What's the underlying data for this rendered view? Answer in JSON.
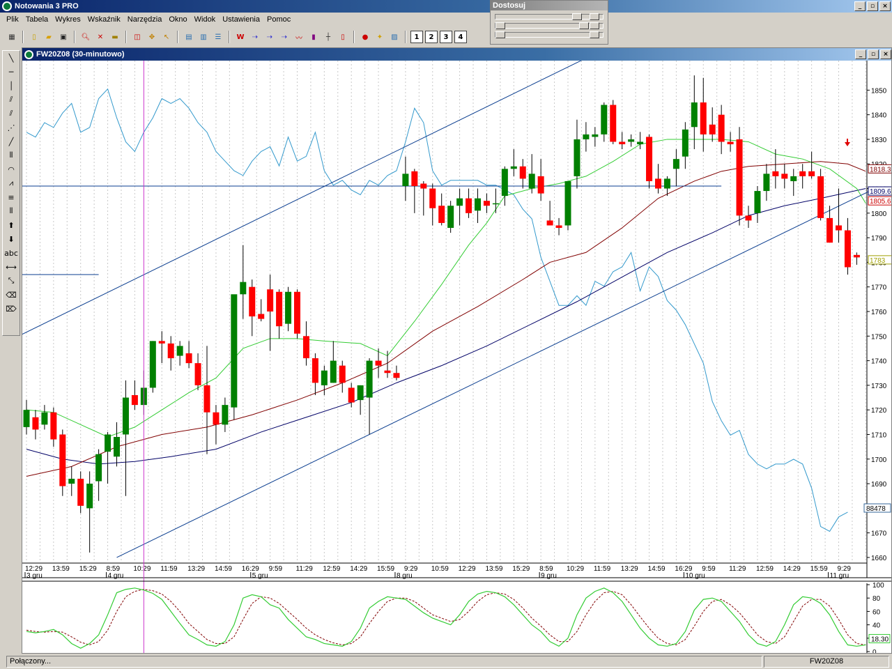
{
  "app": {
    "title": "Notowania 3 PRO",
    "window_buttons": [
      "_",
      "▫",
      "×"
    ]
  },
  "menu": [
    "Plik",
    "Tabela",
    "Wykres",
    "Wskaźnik",
    "Narzędzia",
    "Okno",
    "Widok",
    "Ustawienia",
    "Pomoc"
  ],
  "toolbar": {
    "number_buttons": [
      "1",
      "2",
      "3",
      "4"
    ]
  },
  "dostosuj": {
    "title": "Dostosuj"
  },
  "left_tools": {
    "text_tool": "abc"
  },
  "chart_window": {
    "title": "FW20Z08 (30-minutowo)",
    "window_buttons": [
      "_",
      "▫",
      "×"
    ]
  },
  "status": {
    "connection": "Połączony...",
    "symbol": "FW20Z08"
  },
  "colors": {
    "candle_up": "#008000",
    "candle_down": "#ff0000",
    "volume_line": "#3399cc",
    "ma_fast": "#33cc33",
    "ma_mid": "#800000",
    "ma_slow": "#000066",
    "trend_line": "#0a3d8f",
    "cursor_line": "#cc33cc",
    "stoch_k": "#33cc33",
    "stoch_d": "#800000"
  },
  "chart_data": {
    "type": "candlestick",
    "y_ticks": [
      1660,
      1670,
      1680,
      1690,
      1700,
      1710,
      1720,
      1730,
      1740,
      1750,
      1760,
      1770,
      1780,
      1790,
      1800,
      1810,
      1820,
      1830,
      1840,
      1850
    ],
    "ylim": [
      1658,
      1862
    ],
    "time_labels": [
      "12:29",
      "13:59",
      "15:29",
      "8:59",
      "10:29",
      "11:59",
      "13:29",
      "14:59",
      "16:29",
      "9:59",
      "11:29",
      "12:59",
      "14:29",
      "15:59",
      "9:29",
      "10:59",
      "12:29",
      "13:59",
      "15:29",
      "8:59",
      "10:29",
      "11:59",
      "13:29",
      "14:59",
      "16:29",
      "9:59",
      "11:29",
      "12:59",
      "14:29",
      "15:59",
      "9:29"
    ],
    "date_labels": [
      {
        "label": "3 gru",
        "index": 0
      },
      {
        "label": "4 gru",
        "index": 9
      },
      {
        "label": "5 gru",
        "index": 25
      },
      {
        "label": "8 gru",
        "index": 41
      },
      {
        "label": "9 gru",
        "index": 57
      },
      {
        "label": "10 gru",
        "index": 73
      },
      {
        "label": "11 gru",
        "index": 89
      }
    ],
    "candles": [
      {
        "o": 1713,
        "h": 1724,
        "l": 1710,
        "c": 1720
      },
      {
        "o": 1717,
        "h": 1720,
        "l": 1708,
        "c": 1712
      },
      {
        "o": 1714,
        "h": 1722,
        "l": 1712,
        "c": 1719
      },
      {
        "o": 1719,
        "h": 1721,
        "l": 1705,
        "c": 1708
      },
      {
        "o": 1710,
        "h": 1712,
        "l": 1685,
        "c": 1689
      },
      {
        "o": 1690,
        "h": 1697,
        "l": 1685,
        "c": 1692
      },
      {
        "o": 1692,
        "h": 1695,
        "l": 1678,
        "c": 1681
      },
      {
        "o": 1680,
        "h": 1695,
        "l": 1662,
        "c": 1690
      },
      {
        "o": 1691,
        "h": 1704,
        "l": 1683,
        "c": 1702
      },
      {
        "o": 1703,
        "h": 1711,
        "l": 1690,
        "c": 1710
      },
      {
        "o": 1701,
        "h": 1715,
        "l": 1697,
        "c": 1709
      },
      {
        "o": 1710,
        "h": 1732,
        "l": 1685,
        "c": 1725
      },
      {
        "o": 1726,
        "h": 1732,
        "l": 1720,
        "c": 1722
      },
      {
        "o": 1722,
        "h": 1736,
        "l": 1718,
        "c": 1729
      },
      {
        "o": 1729,
        "h": 1748,
        "l": 1727,
        "c": 1748
      },
      {
        "o": 1748,
        "h": 1752,
        "l": 1739,
        "c": 1747
      },
      {
        "o": 1747,
        "h": 1750,
        "l": 1736,
        "c": 1741
      },
      {
        "o": 1742,
        "h": 1748,
        "l": 1738,
        "c": 1746
      },
      {
        "o": 1743,
        "h": 1748,
        "l": 1737,
        "c": 1739
      },
      {
        "o": 1739,
        "h": 1743,
        "l": 1728,
        "c": 1730
      },
      {
        "o": 1730,
        "h": 1746,
        "l": 1702,
        "c": 1719
      },
      {
        "o": 1719,
        "h": 1722,
        "l": 1706,
        "c": 1714
      },
      {
        "o": 1714,
        "h": 1725,
        "l": 1711,
        "c": 1722
      },
      {
        "o": 1721,
        "h": 1746,
        "l": 1716,
        "c": 1767
      },
      {
        "o": 1767,
        "h": 1787,
        "l": 1757,
        "c": 1772
      },
      {
        "o": 1770,
        "h": 1773,
        "l": 1750,
        "c": 1758
      },
      {
        "o": 1759,
        "h": 1765,
        "l": 1756,
        "c": 1757
      },
      {
        "o": 1769,
        "h": 1775,
        "l": 1744,
        "c": 1760
      },
      {
        "o": 1768,
        "h": 1769,
        "l": 1749,
        "c": 1754
      },
      {
        "o": 1755,
        "h": 1770,
        "l": 1752,
        "c": 1768
      },
      {
        "o": 1768,
        "h": 1769,
        "l": 1749,
        "c": 1751
      },
      {
        "o": 1750,
        "h": 1756,
        "l": 1738,
        "c": 1741
      },
      {
        "o": 1741,
        "h": 1743,
        "l": 1726,
        "c": 1731
      },
      {
        "o": 1730,
        "h": 1738,
        "l": 1726,
        "c": 1736
      },
      {
        "o": 1731,
        "h": 1748,
        "l": 1731,
        "c": 1740
      },
      {
        "o": 1738,
        "h": 1740,
        "l": 1727,
        "c": 1731
      },
      {
        "o": 1729,
        "h": 1731,
        "l": 1721,
        "c": 1723
      },
      {
        "o": 1724,
        "h": 1730,
        "l": 1718,
        "c": 1730
      },
      {
        "o": 1725,
        "h": 1741,
        "l": 1710,
        "c": 1740
      },
      {
        "o": 1740,
        "h": 1745,
        "l": 1733,
        "c": 1738
      },
      {
        "o": 1736,
        "h": 1744,
        "l": 1733,
        "c": 1735
      },
      {
        "o": 1735,
        "h": 1738,
        "l": 1732,
        "c": 1733
      },
      {
        "o": 1811,
        "h": 1823,
        "l": 1805,
        "c": 1816
      },
      {
        "o": 1817,
        "h": 1818,
        "l": 1800,
        "c": 1811
      },
      {
        "o": 1812,
        "h": 1813,
        "l": 1799,
        "c": 1810
      },
      {
        "o": 1810,
        "h": 1812,
        "l": 1795,
        "c": 1802
      },
      {
        "o": 1803,
        "h": 1808,
        "l": 1795,
        "c": 1796
      },
      {
        "o": 1794,
        "h": 1805,
        "l": 1792,
        "c": 1803
      },
      {
        "o": 1803,
        "h": 1810,
        "l": 1795,
        "c": 1806
      },
      {
        "o": 1806,
        "h": 1810,
        "l": 1798,
        "c": 1800
      },
      {
        "o": 1801,
        "h": 1810,
        "l": 1796,
        "c": 1806
      },
      {
        "o": 1805,
        "h": 1808,
        "l": 1800,
        "c": 1803
      },
      {
        "o": 1804,
        "h": 1810,
        "l": 1800,
        "c": 1804
      },
      {
        "o": 1807,
        "h": 1819,
        "l": 1803,
        "c": 1818
      },
      {
        "o": 1818,
        "h": 1826,
        "l": 1815,
        "c": 1819
      },
      {
        "o": 1819,
        "h": 1822,
        "l": 1810,
        "c": 1814
      },
      {
        "o": 1810,
        "h": 1824,
        "l": 1808,
        "c": 1816
      },
      {
        "o": 1815,
        "h": 1822,
        "l": 1805,
        "c": 1808
      },
      {
        "o": 1797,
        "h": 1805,
        "l": 1795,
        "c": 1795
      },
      {
        "o": 1795,
        "h": 1798,
        "l": 1791,
        "c": 1794
      },
      {
        "o": 1795,
        "h": 1800,
        "l": 1793,
        "c": 1813
      },
      {
        "o": 1815,
        "h": 1838,
        "l": 1810,
        "c": 1830
      },
      {
        "o": 1830,
        "h": 1837,
        "l": 1825,
        "c": 1832
      },
      {
        "o": 1831,
        "h": 1835,
        "l": 1827,
        "c": 1832
      },
      {
        "o": 1832,
        "h": 1845,
        "l": 1829,
        "c": 1844
      },
      {
        "o": 1844,
        "h": 1846,
        "l": 1828,
        "c": 1829
      },
      {
        "o": 1829,
        "h": 1833,
        "l": 1826,
        "c": 1828
      },
      {
        "o": 1829,
        "h": 1832,
        "l": 1827,
        "c": 1830
      },
      {
        "o": 1828,
        "h": 1833,
        "l": 1826,
        "c": 1829
      },
      {
        "o": 1831,
        "h": 1832,
        "l": 1810,
        "c": 1813
      },
      {
        "o": 1814,
        "h": 1820,
        "l": 1808,
        "c": 1810
      },
      {
        "o": 1810,
        "h": 1815,
        "l": 1807,
        "c": 1814
      },
      {
        "o": 1818,
        "h": 1826,
        "l": 1811,
        "c": 1822
      },
      {
        "o": 1823,
        "h": 1837,
        "l": 1818,
        "c": 1834
      },
      {
        "o": 1835,
        "h": 1856,
        "l": 1826,
        "c": 1845
      },
      {
        "o": 1845,
        "h": 1855,
        "l": 1825,
        "c": 1832
      },
      {
        "o": 1836,
        "h": 1843,
        "l": 1829,
        "c": 1832
      },
      {
        "o": 1840,
        "h": 1844,
        "l": 1824,
        "c": 1829
      },
      {
        "o": 1829,
        "h": 1833,
        "l": 1825,
        "c": 1828
      },
      {
        "o": 1830,
        "h": 1835,
        "l": 1795,
        "c": 1799
      },
      {
        "o": 1799,
        "h": 1803,
        "l": 1794,
        "c": 1797
      },
      {
        "o": 1800,
        "h": 1811,
        "l": 1796,
        "c": 1809
      },
      {
        "o": 1809,
        "h": 1820,
        "l": 1805,
        "c": 1816
      },
      {
        "o": 1817,
        "h": 1826,
        "l": 1810,
        "c": 1815
      },
      {
        "o": 1816,
        "h": 1820,
        "l": 1810,
        "c": 1814
      },
      {
        "o": 1813,
        "h": 1818,
        "l": 1807,
        "c": 1815
      },
      {
        "o": 1817,
        "h": 1820,
        "l": 1810,
        "c": 1815
      },
      {
        "o": 1817,
        "h": 1825,
        "l": 1814,
        "c": 1815
      },
      {
        "o": 1815,
        "h": 1818,
        "l": 1797,
        "c": 1798
      },
      {
        "o": 1798,
        "h": 1803,
        "l": 1788,
        "c": 1788
      },
      {
        "o": 1795,
        "h": 1810,
        "l": 1788,
        "c": 1793
      },
      {
        "o": 1793,
        "h": 1798,
        "l": 1775,
        "c": 1778
      },
      {
        "o": 1783,
        "h": 1784,
        "l": 1779,
        "c": 1782
      }
    ],
    "ma_fast_points": [
      [
        0,
        1720
      ],
      [
        3,
        1719
      ],
      [
        6,
        1714
      ],
      [
        9,
        1709
      ],
      [
        12,
        1713
      ],
      [
        15,
        1720
      ],
      [
        18,
        1727
      ],
      [
        21,
        1733
      ],
      [
        24,
        1745
      ],
      [
        27,
        1749
      ],
      [
        30,
        1749
      ],
      [
        33,
        1748
      ],
      [
        37,
        1747
      ],
      [
        40,
        1742
      ],
      [
        43,
        1756
      ],
      [
        46,
        1771
      ],
      [
        49,
        1787
      ],
      [
        51,
        1796
      ],
      [
        53,
        1807
      ],
      [
        56,
        1810
      ],
      [
        59,
        1812
      ],
      [
        62,
        1815
      ],
      [
        65,
        1821
      ],
      [
        68,
        1828
      ],
      [
        71,
        1830
      ],
      [
        74,
        1830
      ],
      [
        77,
        1830
      ],
      [
        80,
        1829
      ],
      [
        83,
        1824
      ],
      [
        86,
        1822
      ],
      [
        89,
        1818
      ],
      [
        92,
        1810
      ],
      [
        93,
        1804
      ]
    ],
    "ma_mid_points": [
      [
        0,
        1693
      ],
      [
        5,
        1697
      ],
      [
        10,
        1705
      ],
      [
        15,
        1710
      ],
      [
        20,
        1713
      ],
      [
        25,
        1718
      ],
      [
        30,
        1724
      ],
      [
        35,
        1731
      ],
      [
        40,
        1739
      ],
      [
        45,
        1752
      ],
      [
        50,
        1762
      ],
      [
        55,
        1773
      ],
      [
        58,
        1780
      ],
      [
        62,
        1784
      ],
      [
        66,
        1794
      ],
      [
        70,
        1806
      ],
      [
        74,
        1813
      ],
      [
        77,
        1817
      ],
      [
        80,
        1819
      ],
      [
        84,
        1820
      ],
      [
        88,
        1821
      ],
      [
        91,
        1820
      ],
      [
        93,
        1817
      ]
    ],
    "ma_slow_points": [
      [
        0,
        1704
      ],
      [
        4,
        1700
      ],
      [
        8,
        1698
      ],
      [
        12,
        1699
      ],
      [
        16,
        1701
      ],
      [
        21,
        1704
      ],
      [
        26,
        1711
      ],
      [
        31,
        1717
      ],
      [
        36,
        1723
      ],
      [
        41,
        1731
      ],
      [
        46,
        1738
      ],
      [
        51,
        1746
      ],
      [
        56,
        1755
      ],
      [
        61,
        1764
      ],
      [
        66,
        1774
      ],
      [
        71,
        1784
      ],
      [
        76,
        1792
      ],
      [
        80,
        1799
      ],
      [
        84,
        1803
      ],
      [
        88,
        1806
      ],
      [
        93,
        1810
      ]
    ],
    "trend_lines": [
      {
        "from": [
          -2,
          1748
        ],
        "to": [
          62,
          1863
        ]
      },
      {
        "from": [
          10,
          1660
        ],
        "to": [
          94,
          1810
        ]
      }
    ],
    "horizontal_lines": [
      {
        "from": -2,
        "to": 77,
        "y": 1811
      },
      {
        "from": -2,
        "to": 8,
        "y": 1775
      }
    ],
    "cursor_index": 13,
    "price_badges": [
      {
        "value": "1818.35",
        "y": 1818,
        "color": "#800000"
      },
      {
        "value": "1809.69",
        "y": 1809,
        "color": "#000066"
      },
      {
        "value": "1805.67",
        "y": 1805,
        "color": "#cc0000"
      },
      {
        "value": "1783",
        "y": 1781,
        "color": "#a0a000"
      }
    ],
    "secondary_badge": "88478",
    "secondary_series": [
      0.88,
      0.87,
      0.9,
      0.89,
      0.92,
      0.94,
      0.88,
      0.89,
      0.95,
      0.97,
      0.91,
      0.86,
      0.84,
      0.88,
      0.91,
      0.95,
      0.94,
      0.95,
      0.93,
      0.9,
      0.88,
      0.84,
      0.82,
      0.8,
      0.79,
      0.82,
      0.84,
      0.85,
      0.81,
      0.87,
      0.82,
      0.83,
      0.88,
      0.8,
      0.77,
      0.78,
      0.76,
      0.75,
      0.78,
      0.77,
      0.79,
      0.8,
      0.86,
      0.93,
      0.9,
      0.8,
      0.77,
      0.78,
      0.78,
      0.78,
      0.78,
      0.77,
      0.77,
      0.76,
      0.75,
      0.72,
      0.7,
      0.62,
      0.57,
      0.52,
      0.52,
      0.54,
      0.52,
      0.57,
      0.56,
      0.59,
      0.6,
      0.63,
      0.55,
      0.6,
      0.58,
      0.53,
      0.51,
      0.48,
      0.44,
      0.4,
      0.32,
      0.28,
      0.25,
      0.26,
      0.21,
      0.19,
      0.18,
      0.19,
      0.19,
      0.2,
      0.19,
      0.14,
      0.06,
      0.05,
      0.08,
      0.09
    ],
    "stochastic": {
      "levels": [
        0,
        20,
        40,
        60,
        80,
        100
      ],
      "badge": "18.30",
      "k": [
        30,
        28,
        30,
        33,
        25,
        12,
        5,
        12,
        25,
        55,
        88,
        93,
        95,
        92,
        87,
        78,
        60,
        42,
        25,
        18,
        10,
        8,
        15,
        40,
        80,
        85,
        82,
        70,
        65,
        48,
        35,
        22,
        18,
        12,
        10,
        8,
        15,
        35,
        65,
        75,
        82,
        80,
        78,
        68,
        58,
        50,
        45,
        40,
        55,
        75,
        86,
        90,
        88,
        82,
        70,
        55,
        40,
        30,
        15,
        8,
        20,
        55,
        80,
        90,
        95,
        88,
        75,
        55,
        35,
        20,
        10,
        8,
        12,
        30,
        62,
        78,
        80,
        75,
        60,
        45,
        25,
        12,
        8,
        15,
        40,
        70,
        82,
        80,
        72,
        55,
        30,
        10,
        8,
        10
      ],
      "d": [
        32,
        30,
        29,
        30,
        29,
        22,
        14,
        10,
        15,
        32,
        60,
        82,
        90,
        93,
        91,
        86,
        75,
        60,
        42,
        30,
        18,
        12,
        12,
        22,
        48,
        72,
        82,
        80,
        72,
        60,
        48,
        35,
        25,
        18,
        13,
        10,
        12,
        22,
        42,
        60,
        75,
        80,
        80,
        75,
        65,
        55,
        50,
        45,
        48,
        60,
        75,
        85,
        88,
        86,
        78,
        65,
        50,
        38,
        25,
        15,
        15,
        30,
        55,
        75,
        88,
        90,
        85,
        70,
        52,
        35,
        20,
        12,
        10,
        18,
        38,
        60,
        75,
        78,
        70,
        58,
        42,
        25,
        15,
        12,
        22,
        45,
        68,
        78,
        78,
        68,
        48,
        25,
        12,
        10
      ]
    }
  }
}
